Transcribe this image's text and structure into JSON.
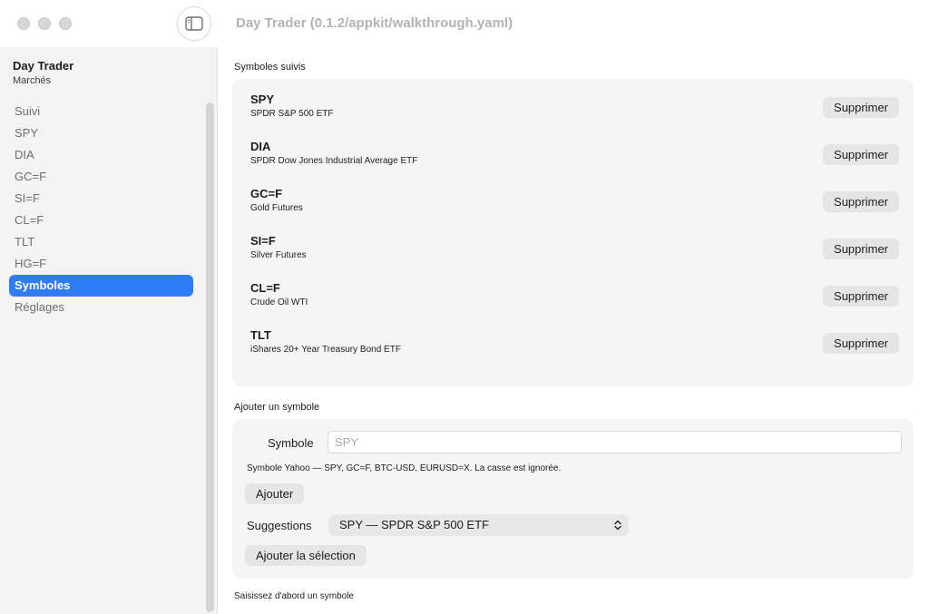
{
  "window": {
    "title": "Day Trader (0.1.2/appkit/walkthrough.yaml)"
  },
  "sidebar": {
    "app_title": "Day Trader",
    "app_subtitle": "Marchés",
    "items": [
      {
        "label": "Suivi"
      },
      {
        "label": "SPY"
      },
      {
        "label": "DIA"
      },
      {
        "label": "GC=F"
      },
      {
        "label": "SI=F"
      },
      {
        "label": "CL=F"
      },
      {
        "label": "TLT"
      },
      {
        "label": "HG=F"
      },
      {
        "label": "Symboles",
        "selected": true
      },
      {
        "label": "Réglages"
      }
    ]
  },
  "tracked": {
    "section_label": "Symboles suivis",
    "remove_label": "Supprimer",
    "symbols": [
      {
        "ticker": "SPY",
        "name": "SPDR S&P 500 ETF"
      },
      {
        "ticker": "DIA",
        "name": "SPDR Dow Jones Industrial Average ETF"
      },
      {
        "ticker": "GC=F",
        "name": "Gold Futures"
      },
      {
        "ticker": "SI=F",
        "name": "Silver Futures"
      },
      {
        "ticker": "CL=F",
        "name": "Crude Oil WTI"
      },
      {
        "ticker": "TLT",
        "name": "iShares 20+ Year Treasury Bond ETF"
      }
    ]
  },
  "add": {
    "section_label": "Ajouter un symbole",
    "symbol_label": "Symbole",
    "symbol_placeholder": "SPY",
    "symbol_value": "",
    "hint": "Symbole Yahoo — SPY, GC=F, BTC-USD, EURUSD=X. La casse est ignorée.",
    "add_button": "Ajouter",
    "suggestions_label": "Suggestions",
    "suggestion_selected": "SPY — SPDR S&P 500 ETF",
    "add_selection_button": "Ajouter la sélection"
  },
  "status": {
    "message": "Saisissez d'abord un symbole"
  },
  "colors": {
    "accent": "#2f7cf6"
  }
}
